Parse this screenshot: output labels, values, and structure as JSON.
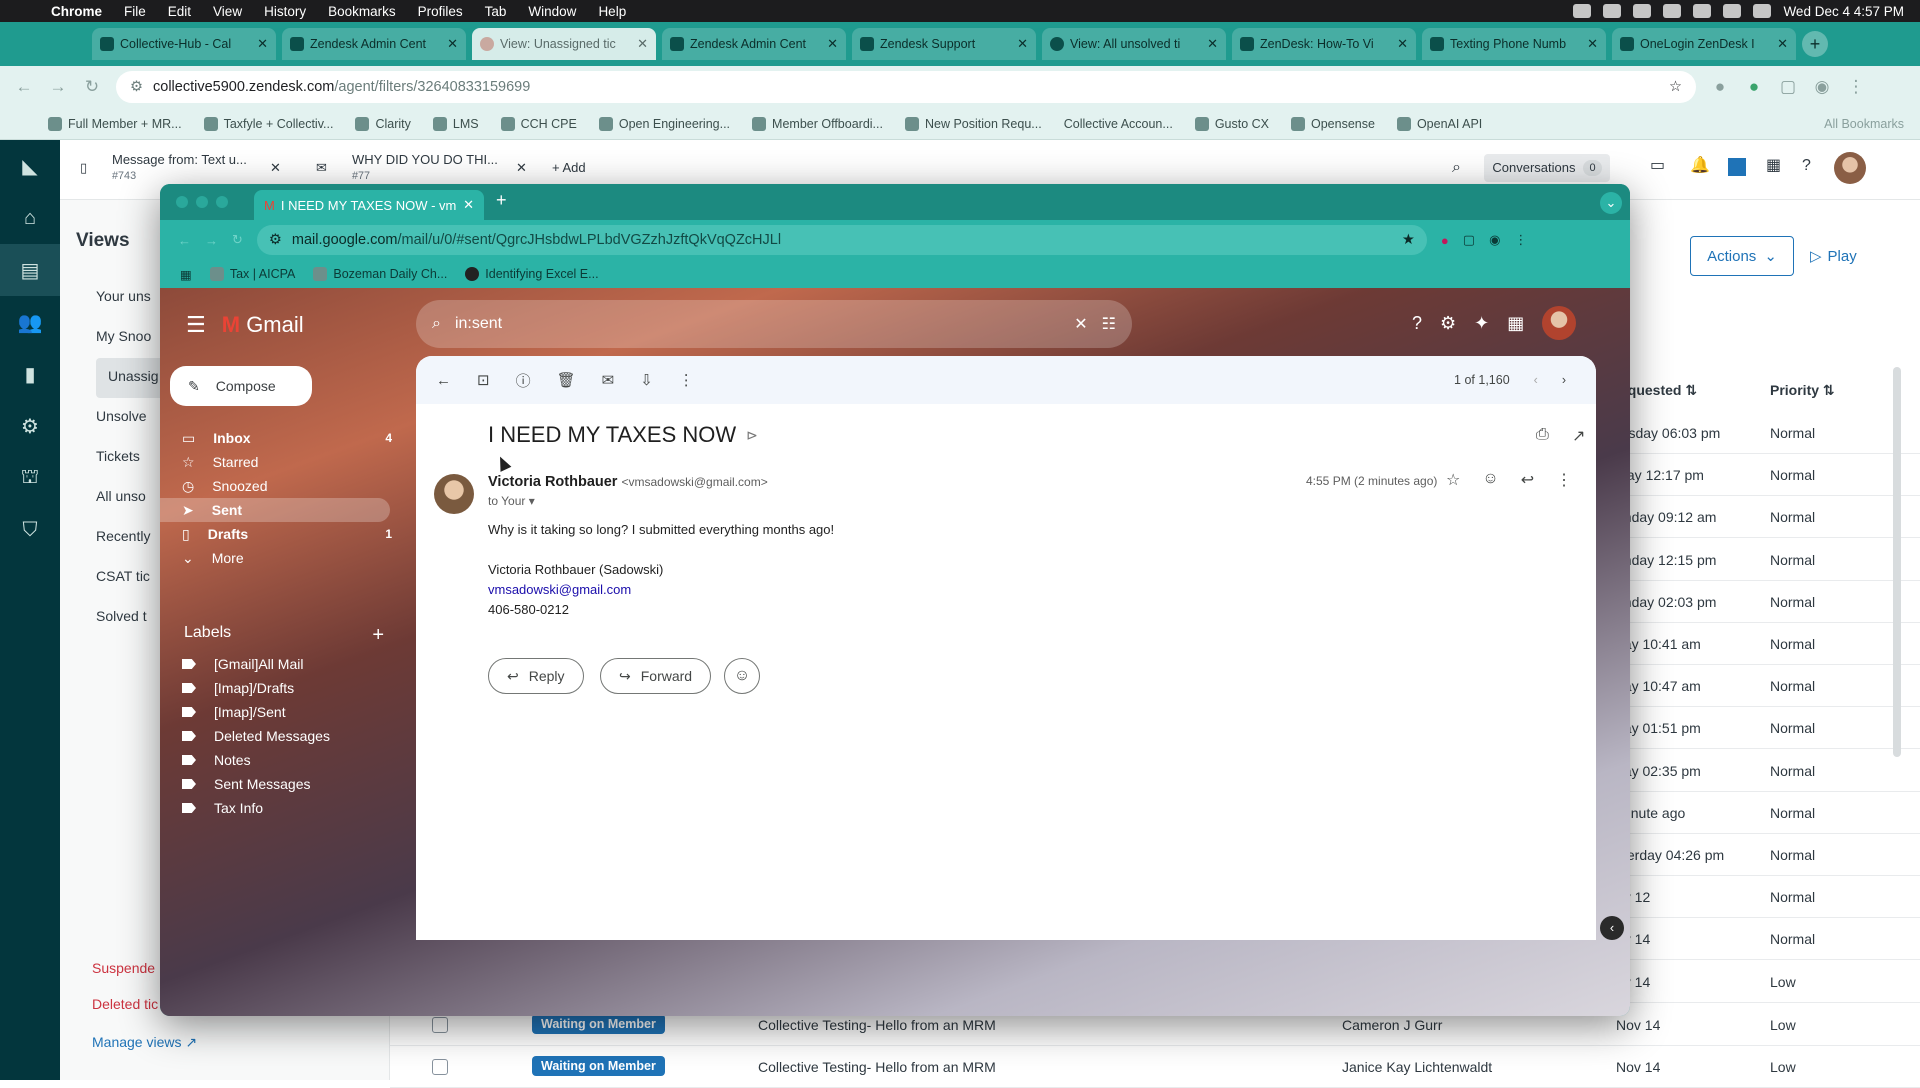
{
  "menubar": {
    "app": "Chrome",
    "items": [
      "File",
      "Edit",
      "View",
      "History",
      "Bookmarks",
      "Profiles",
      "Tab",
      "Window",
      "Help"
    ],
    "clock": "Wed Dec 4  4:57 PM"
  },
  "outer_tabs": [
    {
      "title": "Collective-Hub - Cal"
    },
    {
      "title": "Zendesk Admin Cent"
    },
    {
      "title": "View: Unassigned tic"
    },
    {
      "title": "Zendesk Admin Cent"
    },
    {
      "title": "Zendesk Support"
    },
    {
      "title": "View: All unsolved ti"
    },
    {
      "title": "ZenDesk: How-To Vi"
    },
    {
      "title": "Texting Phone Numb"
    },
    {
      "title": "OneLogin ZenDesk I"
    }
  ],
  "outer_url": {
    "host": "collective5900.zendesk.com",
    "path": "/agent/filters/32640833159699"
  },
  "bookmarks": [
    "Full Member + MR...",
    "Taxfyle + Collectiv...",
    "Clarity",
    "LMS",
    "CCH CPE",
    "Open Engineering...",
    "Member Offboardi...",
    "New Position Requ...",
    "Collective Accoun...",
    "Gusto CX",
    "Opensense",
    "OpenAI API"
  ],
  "bookmarks_all": "All Bookmarks",
  "zendesk": {
    "tabs": [
      {
        "title": "Message from: Text u...",
        "sub": "#743"
      },
      {
        "title": "WHY DID YOU DO THI...",
        "sub": "#77"
      }
    ],
    "add_label": "+ Add",
    "conversations_label": "Conversations",
    "conversations_count": "0",
    "views_title": "Views",
    "views": [
      "Your uns",
      "My Snoo",
      "Unassig",
      "Unsolve",
      "Tickets",
      "All unso",
      "Recently",
      "CSAT tic",
      "Solved t"
    ],
    "suspended": "Suspende",
    "deleted": "Deleted tic",
    "manage_views": "Manage views",
    "actions_label": "Actions",
    "play_label": "Play",
    "col_requested": "equested",
    "col_priority": "Priority",
    "rows": [
      {
        "req": "ursday 06:03 pm",
        "pri": "Normal"
      },
      {
        "req": "iday 12:17 pm",
        "pri": "Normal"
      },
      {
        "req": "onday 09:12 am",
        "pri": "Normal"
      },
      {
        "req": "onday 12:15 pm",
        "pri": "Normal"
      },
      {
        "req": "onday 02:03 pm",
        "pri": "Normal"
      },
      {
        "req": "day 10:41 am",
        "pri": "Normal"
      },
      {
        "req": "day 10:47 am",
        "pri": "Normal"
      },
      {
        "req": "day 01:51 pm",
        "pri": "Normal"
      },
      {
        "req": "day 02:35 pm",
        "pri": "Normal"
      },
      {
        "req": "minute ago",
        "pri": "Normal"
      },
      {
        "req": "sterday 04:26 pm",
        "pri": "Normal"
      },
      {
        "req": "ov 12",
        "pri": "Normal"
      },
      {
        "req": "ov 14",
        "pri": "Normal"
      },
      {
        "req": "ov 14",
        "pri": "Low"
      }
    ],
    "bottom_rows": [
      {
        "status": "Waiting on Member",
        "subject": "Collective Testing- Hello from an MRM",
        "requester": "Cameron J Gurr",
        "req": "Nov 14",
        "pri": "Low"
      },
      {
        "status": "Waiting on Member",
        "subject": "Collective Testing- Hello from an MRM",
        "requester": "Janice Kay Lichtenwaldt",
        "req": "Nov 14",
        "pri": "Low"
      }
    ]
  },
  "inner": {
    "tab_title": "I NEED MY TAXES NOW - vm",
    "url_host": "mail.google.com",
    "url_path": "/mail/u/0/#sent/QgrcJHsbdwLPLbdVGZzhJzftQkVqQZcHJLl",
    "bookmarks": [
      "Tax | AICPA",
      "Bozeman Daily Ch...",
      "Identifying Excel E..."
    ]
  },
  "gmail": {
    "logo": "Gmail",
    "search": "in:sent",
    "compose": "Compose",
    "nav": [
      {
        "label": "Inbox",
        "count": "4"
      },
      {
        "label": "Starred",
        "count": ""
      },
      {
        "label": "Snoozed",
        "count": ""
      },
      {
        "label": "Sent",
        "count": ""
      },
      {
        "label": "Drafts",
        "count": "1"
      },
      {
        "label": "More",
        "count": ""
      }
    ],
    "labels_title": "Labels",
    "labels": [
      "[Gmail]All Mail",
      "[Imap]/Drafts",
      "[Imap]/Sent",
      "Deleted Messages",
      "Notes",
      "Sent Messages",
      "Tax Info"
    ],
    "pagination": "1 of 1,160",
    "message": {
      "subject": "I NEED MY TAXES NOW",
      "sender_name": "Victoria Rothbauer",
      "sender_email": "<vmsadowski@gmail.com>",
      "to": "to Your",
      "time": "4:55 PM (2 minutes ago)",
      "body": "Why is it taking so long? I submitted everything months ago!",
      "sig_name": "Victoria Rothbauer (Sadowski)",
      "sig_email": "vmsadowski@gmail.com",
      "sig_phone": "406-580-0212"
    },
    "reply": "Reply",
    "forward": "Forward"
  },
  "colors": {
    "chrome_teal": "#1f9b8f",
    "zendesk_nav": "#03363d",
    "zendesk_blue": "#1f73b7"
  }
}
